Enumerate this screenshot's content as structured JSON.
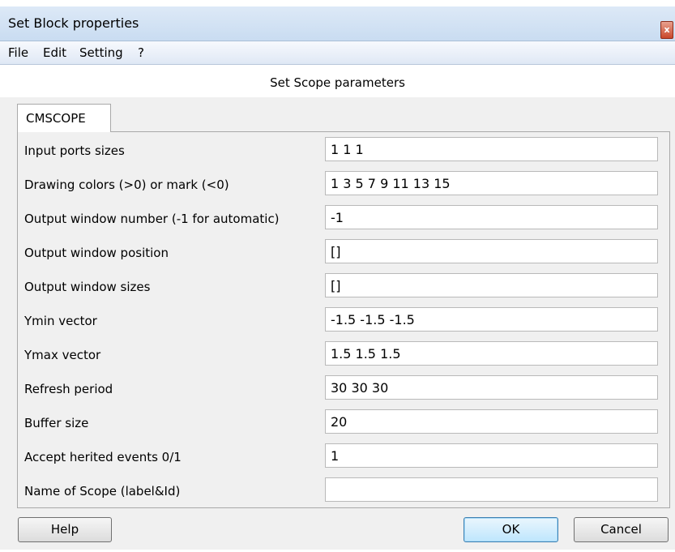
{
  "window": {
    "title": "Set Block properties",
    "close_glyph": "x"
  },
  "menu": {
    "items": [
      "File",
      "Edit",
      "Setting",
      "?"
    ]
  },
  "header": {
    "title": "Set Scope parameters"
  },
  "tab": {
    "label": "CMSCOPE"
  },
  "params": [
    {
      "label": "Input ports sizes",
      "value": "1 1 1"
    },
    {
      "label": "Drawing colors (>0) or mark (<0)",
      "value": "1 3 5 7 9 11 13 15"
    },
    {
      "label": "Output window number (-1 for automatic)",
      "value": "-1"
    },
    {
      "label": "Output window position",
      "value": "[]"
    },
    {
      "label": "Output window sizes",
      "value": "[]"
    },
    {
      "label": "Ymin vector",
      "value": "-1.5 -1.5 -1.5"
    },
    {
      "label": "Ymax vector",
      "value": "1.5 1.5 1.5"
    },
    {
      "label": "Refresh period",
      "value": "30 30 30"
    },
    {
      "label": "Buffer size",
      "value": "20"
    },
    {
      "label": "Accept herited events 0/1",
      "value": "1"
    },
    {
      "label": "Name of Scope (label&Id)",
      "value": ""
    }
  ],
  "buttons": {
    "help": "Help",
    "ok": "OK",
    "cancel": "Cancel"
  },
  "colors": {
    "titlebar": "#c9dcf1",
    "close": "#c9472b",
    "ok_border": "#3c7fb1"
  }
}
